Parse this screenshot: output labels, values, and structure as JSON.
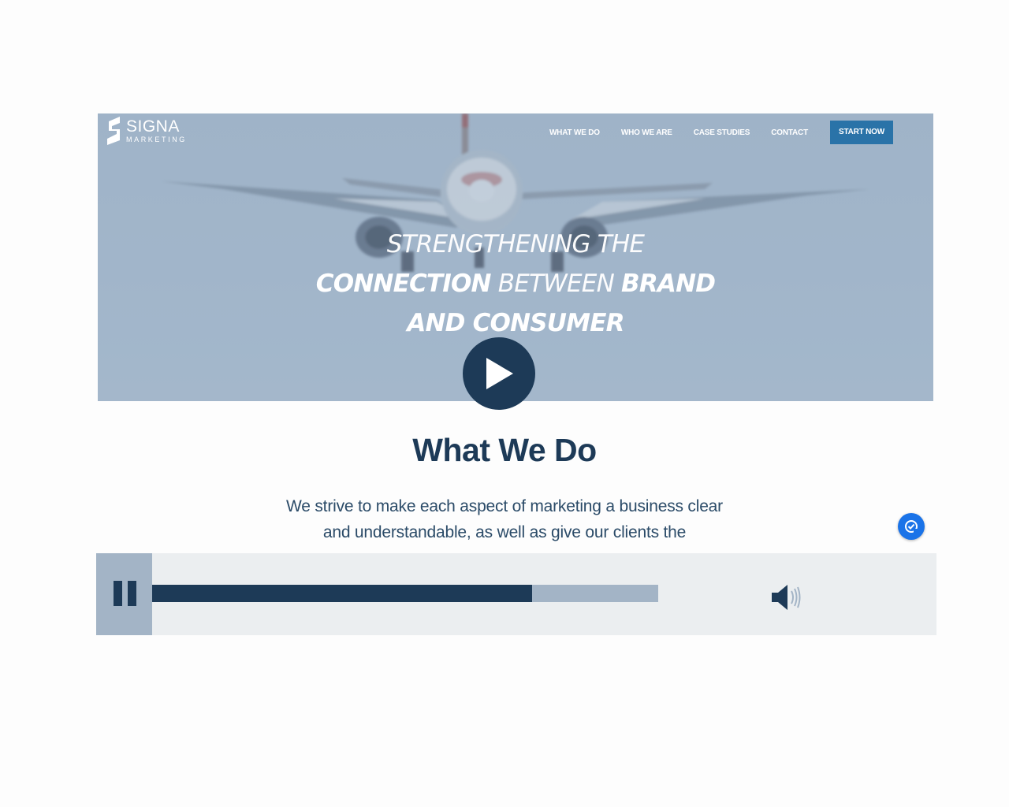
{
  "brand": {
    "name": "SIGNA",
    "subtitle": "MARKETING"
  },
  "nav": {
    "items": [
      "WHAT WE DO",
      "WHO WE ARE",
      "CASE STUDIES",
      "CONTACT"
    ],
    "cta": "START NOW"
  },
  "hero": {
    "line1": "STRENGTHENING THE",
    "line2_a": "CONNECTION",
    "line2_b": "BETWEEN",
    "line2_c": "BRAND",
    "line3": "AND CONSUMER"
  },
  "section": {
    "title": "What We Do",
    "text": "We strive to make each aspect of marketing a business clear and understandable, as well as give our clients the"
  },
  "player": {
    "progress": 0.75,
    "state": "playing"
  },
  "colors": {
    "navy": "#1d3a57",
    "cta_blue": "#2a73a8",
    "chat_blue": "#1a73e8",
    "player_bg": "#ebeef0",
    "player_track": "#a3b4c6"
  },
  "icons": [
    "play-icon",
    "pause-icon",
    "volume-icon",
    "chat-check-icon",
    "logo-mark-icon"
  ]
}
